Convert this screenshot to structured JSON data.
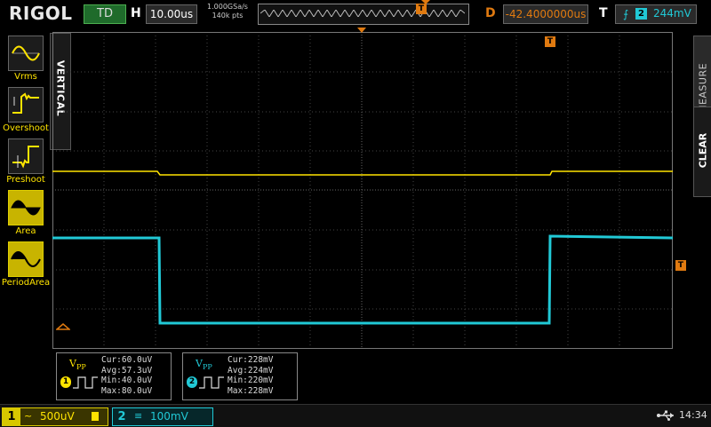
{
  "header": {
    "brand": "RIGOL",
    "run_status": "TD",
    "timebase_label": "H",
    "timebase_value": "10.00us",
    "sample_rate": "1.000GSa/s",
    "memory_depth": "140k pts",
    "delay_label": "D",
    "delay_value": "-42.4000000us",
    "trigger_label": "T",
    "trigger_source": "2",
    "trigger_level": "244mV"
  },
  "left_panel": {
    "tab_title": "VERTICAL",
    "items": [
      {
        "label": "Vrms",
        "icon": "vrms-icon"
      },
      {
        "label": "Overshoot",
        "icon": "overshoot-icon"
      },
      {
        "label": "Preshoot",
        "icon": "preshoot-icon"
      },
      {
        "label": "Area",
        "icon": "area-icon"
      },
      {
        "label": "PeriodArea",
        "icon": "period-area-icon"
      }
    ]
  },
  "right_panel": {
    "measure_tab": "MEASURE",
    "clear_tab": "CLEAR"
  },
  "markers": {
    "trigger_marker": "T",
    "trigger_level_marker": "T",
    "mem_window_marker": "T"
  },
  "measurements": [
    {
      "channel": "1",
      "param": "V",
      "param_sub": "PP",
      "lines": [
        "Cur:60.0uV",
        "Avg:57.3uV",
        "Min:40.0uV",
        "Max:80.0uV"
      ],
      "color": "#ffe400"
    },
    {
      "channel": "2",
      "param": "V",
      "param_sub": "PP",
      "lines": [
        "Cur:228mV",
        "Avg:224mV",
        "Min:220mV",
        "Max:228mV"
      ],
      "color": "#21c9d6"
    }
  ],
  "channels": [
    {
      "number": "1",
      "coupling": "~",
      "scale": "500uV",
      "color": "#ffe400"
    },
    {
      "number": "2",
      "coupling": "≡",
      "scale": "100mV",
      "color": "#21c9d6"
    }
  ],
  "status": {
    "time": "14:34"
  },
  "colors": {
    "ch1": "#ffe400",
    "ch2": "#21c9d6",
    "accent": "#e07a10",
    "grid": "#555555"
  }
}
